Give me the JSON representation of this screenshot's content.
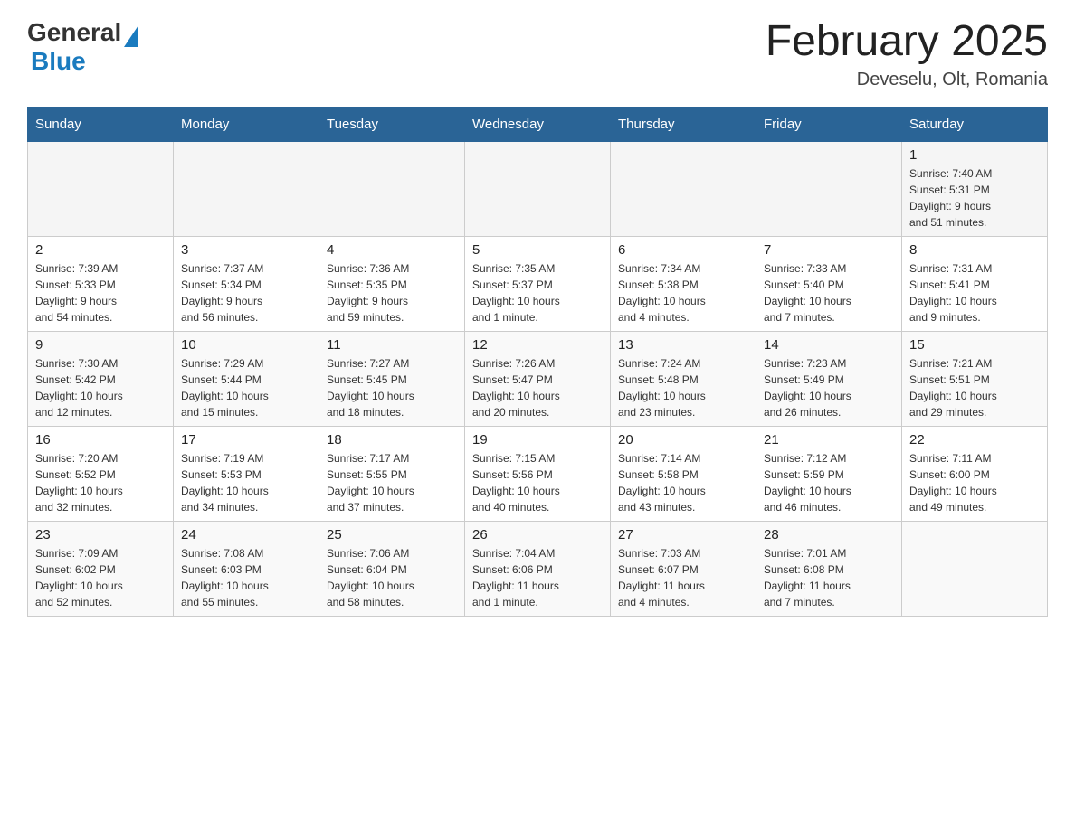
{
  "header": {
    "title": "February 2025",
    "subtitle": "Deveselu, Olt, Romania",
    "logo_general": "General",
    "logo_blue": "Blue"
  },
  "weekdays": [
    "Sunday",
    "Monday",
    "Tuesday",
    "Wednesday",
    "Thursday",
    "Friday",
    "Saturday"
  ],
  "weeks": [
    [
      {
        "day": "",
        "info": ""
      },
      {
        "day": "",
        "info": ""
      },
      {
        "day": "",
        "info": ""
      },
      {
        "day": "",
        "info": ""
      },
      {
        "day": "",
        "info": ""
      },
      {
        "day": "",
        "info": ""
      },
      {
        "day": "1",
        "info": "Sunrise: 7:40 AM\nSunset: 5:31 PM\nDaylight: 9 hours\nand 51 minutes."
      }
    ],
    [
      {
        "day": "2",
        "info": "Sunrise: 7:39 AM\nSunset: 5:33 PM\nDaylight: 9 hours\nand 54 minutes."
      },
      {
        "day": "3",
        "info": "Sunrise: 7:37 AM\nSunset: 5:34 PM\nDaylight: 9 hours\nand 56 minutes."
      },
      {
        "day": "4",
        "info": "Sunrise: 7:36 AM\nSunset: 5:35 PM\nDaylight: 9 hours\nand 59 minutes."
      },
      {
        "day": "5",
        "info": "Sunrise: 7:35 AM\nSunset: 5:37 PM\nDaylight: 10 hours\nand 1 minute."
      },
      {
        "day": "6",
        "info": "Sunrise: 7:34 AM\nSunset: 5:38 PM\nDaylight: 10 hours\nand 4 minutes."
      },
      {
        "day": "7",
        "info": "Sunrise: 7:33 AM\nSunset: 5:40 PM\nDaylight: 10 hours\nand 7 minutes."
      },
      {
        "day": "8",
        "info": "Sunrise: 7:31 AM\nSunset: 5:41 PM\nDaylight: 10 hours\nand 9 minutes."
      }
    ],
    [
      {
        "day": "9",
        "info": "Sunrise: 7:30 AM\nSunset: 5:42 PM\nDaylight: 10 hours\nand 12 minutes."
      },
      {
        "day": "10",
        "info": "Sunrise: 7:29 AM\nSunset: 5:44 PM\nDaylight: 10 hours\nand 15 minutes."
      },
      {
        "day": "11",
        "info": "Sunrise: 7:27 AM\nSunset: 5:45 PM\nDaylight: 10 hours\nand 18 minutes."
      },
      {
        "day": "12",
        "info": "Sunrise: 7:26 AM\nSunset: 5:47 PM\nDaylight: 10 hours\nand 20 minutes."
      },
      {
        "day": "13",
        "info": "Sunrise: 7:24 AM\nSunset: 5:48 PM\nDaylight: 10 hours\nand 23 minutes."
      },
      {
        "day": "14",
        "info": "Sunrise: 7:23 AM\nSunset: 5:49 PM\nDaylight: 10 hours\nand 26 minutes."
      },
      {
        "day": "15",
        "info": "Sunrise: 7:21 AM\nSunset: 5:51 PM\nDaylight: 10 hours\nand 29 minutes."
      }
    ],
    [
      {
        "day": "16",
        "info": "Sunrise: 7:20 AM\nSunset: 5:52 PM\nDaylight: 10 hours\nand 32 minutes."
      },
      {
        "day": "17",
        "info": "Sunrise: 7:19 AM\nSunset: 5:53 PM\nDaylight: 10 hours\nand 34 minutes."
      },
      {
        "day": "18",
        "info": "Sunrise: 7:17 AM\nSunset: 5:55 PM\nDaylight: 10 hours\nand 37 minutes."
      },
      {
        "day": "19",
        "info": "Sunrise: 7:15 AM\nSunset: 5:56 PM\nDaylight: 10 hours\nand 40 minutes."
      },
      {
        "day": "20",
        "info": "Sunrise: 7:14 AM\nSunset: 5:58 PM\nDaylight: 10 hours\nand 43 minutes."
      },
      {
        "day": "21",
        "info": "Sunrise: 7:12 AM\nSunset: 5:59 PM\nDaylight: 10 hours\nand 46 minutes."
      },
      {
        "day": "22",
        "info": "Sunrise: 7:11 AM\nSunset: 6:00 PM\nDaylight: 10 hours\nand 49 minutes."
      }
    ],
    [
      {
        "day": "23",
        "info": "Sunrise: 7:09 AM\nSunset: 6:02 PM\nDaylight: 10 hours\nand 52 minutes."
      },
      {
        "day": "24",
        "info": "Sunrise: 7:08 AM\nSunset: 6:03 PM\nDaylight: 10 hours\nand 55 minutes."
      },
      {
        "day": "25",
        "info": "Sunrise: 7:06 AM\nSunset: 6:04 PM\nDaylight: 10 hours\nand 58 minutes."
      },
      {
        "day": "26",
        "info": "Sunrise: 7:04 AM\nSunset: 6:06 PM\nDaylight: 11 hours\nand 1 minute."
      },
      {
        "day": "27",
        "info": "Sunrise: 7:03 AM\nSunset: 6:07 PM\nDaylight: 11 hours\nand 4 minutes."
      },
      {
        "day": "28",
        "info": "Sunrise: 7:01 AM\nSunset: 6:08 PM\nDaylight: 11 hours\nand 7 minutes."
      },
      {
        "day": "",
        "info": ""
      }
    ]
  ]
}
